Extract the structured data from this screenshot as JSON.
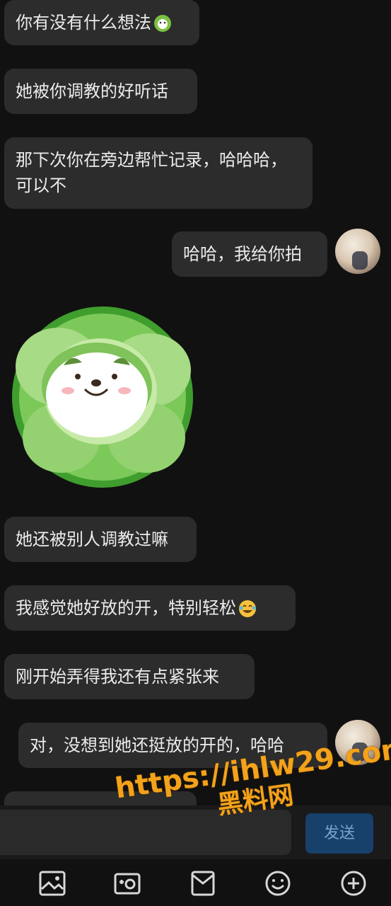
{
  "messages": [
    {
      "side": "left",
      "text": "你有没有什么想法"
    },
    {
      "side": "left",
      "text": "她被你调教的好听话"
    },
    {
      "side": "left",
      "text": "那下次你在旁边帮忙记录，哈哈哈，可以不"
    },
    {
      "side": "right",
      "text": "哈哈，我给你拍"
    },
    {
      "side": "left",
      "text": "她还被别人调教过嘛"
    },
    {
      "side": "left",
      "text": "我感觉她好放的开，特别轻松"
    },
    {
      "side": "left",
      "text": "刚开始弄得我还有点紧张来"
    },
    {
      "side": "right",
      "text": "对，没想到她还挺放的开的，哈哈"
    }
  ],
  "composer": {
    "send_label": "发送",
    "input_value": ""
  },
  "toolbar": {
    "icons": [
      "image-icon",
      "camera-icon",
      "envelope-icon",
      "smile-icon",
      "plus-circle-icon"
    ]
  },
  "watermark": {
    "url": "https://ihlw29.com",
    "name": "黑料网"
  },
  "colors": {
    "background": "#111111",
    "bubble": "#2c2c2c",
    "send_button": "#17406a",
    "watermark": "#f3a21a"
  }
}
